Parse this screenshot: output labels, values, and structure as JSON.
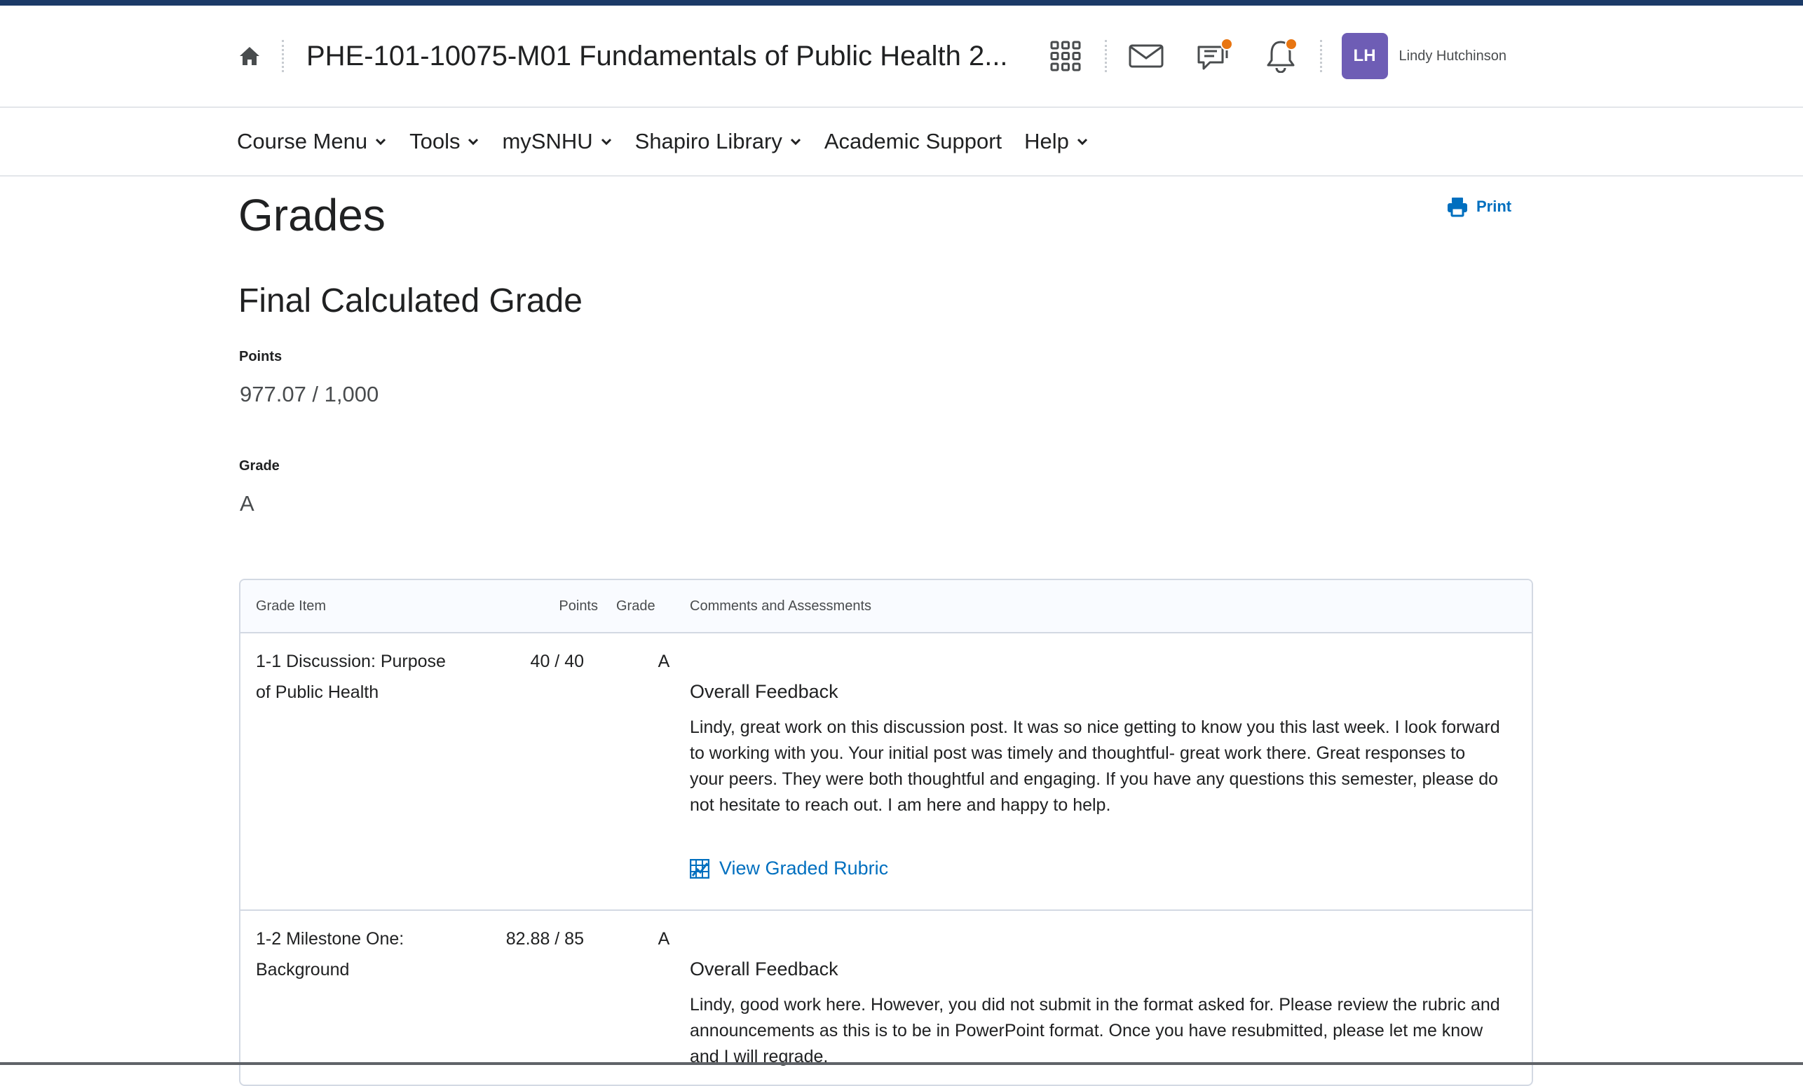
{
  "header": {
    "course_title": "PHE-101-10075-M01 Fundamentals of Public Health 2...",
    "user_initials": "LH",
    "user_name": "Lindy Hutchinson",
    "icons": [
      "home-icon",
      "waffle-grid-icon",
      "mail-icon",
      "chat-icon",
      "bell-icon"
    ]
  },
  "menu": {
    "items": [
      {
        "label": "Course Menu",
        "has_dropdown": true
      },
      {
        "label": "Tools",
        "has_dropdown": true
      },
      {
        "label": "mySNHU",
        "has_dropdown": true
      },
      {
        "label": "Shapiro Library",
        "has_dropdown": true
      },
      {
        "label": "Academic Support",
        "has_dropdown": false
      },
      {
        "label": "Help",
        "has_dropdown": true
      }
    ]
  },
  "page": {
    "title": "Grades",
    "print_label": "Print"
  },
  "final_grade": {
    "title": "Final Calculated Grade",
    "points_label": "Points",
    "points_value": "977.07 / 1,000",
    "grade_label": "Grade",
    "grade_value": "A"
  },
  "table": {
    "headers": {
      "item": "Grade Item",
      "points": "Points",
      "grade": "Grade",
      "comments": "Comments and Assessments"
    },
    "rows": [
      {
        "item": "1-1 Discussion: Purpose of Public Health",
        "points": "40 / 40",
        "grade": "A",
        "feedback_label": "Overall Feedback",
        "feedback": "Lindy, great work on this discussion post. It was so nice getting to know you this last week. I look forward to working with you. Your initial post was timely and thoughtful- great work there. Great responses to your peers. They were both thoughtful and engaging. If you have any questions this semester, please do not hesitate to reach out. I am here and happy to help.",
        "rubric_link": "View Graded Rubric"
      },
      {
        "item": "1-2 Milestone One: Background",
        "points": "82.88 / 85",
        "grade": "A",
        "feedback_label": "Overall Feedback",
        "feedback": "Lindy, good work here. However, you did not submit in the format asked for. Please review the rubric and announcements as this is to be in PowerPoint format. Once you have resubmitted, please let me know and I will regrade."
      }
    ]
  },
  "colors": {
    "top_stripe": "#1b3a67",
    "avatar": "#6e5db5",
    "link": "#006fbf",
    "notification_dot": "#e87511"
  }
}
